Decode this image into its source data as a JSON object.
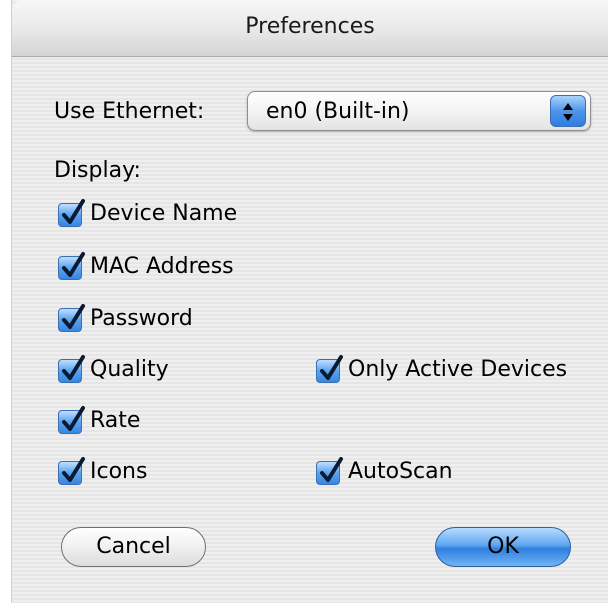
{
  "window": {
    "title": "Preferences"
  },
  "ethernet": {
    "label": "Use Ethernet:",
    "selected": "en0 (Built-in)"
  },
  "display": {
    "label": "Display:",
    "checkboxes": [
      {
        "label": "Device Name",
        "checked": true
      },
      {
        "label": "MAC Address",
        "checked": true
      },
      {
        "label": "Password",
        "checked": true
      },
      {
        "label": "Quality",
        "checked": true
      },
      {
        "label": "Rate",
        "checked": true
      },
      {
        "label": "Icons",
        "checked": true
      },
      {
        "label": "Only Active Devices",
        "checked": true
      },
      {
        "label": "AutoScan",
        "checked": true
      }
    ]
  },
  "buttons": {
    "cancel": "Cancel",
    "ok": "OK"
  },
  "colors": {
    "accent": "#3786e2",
    "check": "#0a1a33"
  }
}
